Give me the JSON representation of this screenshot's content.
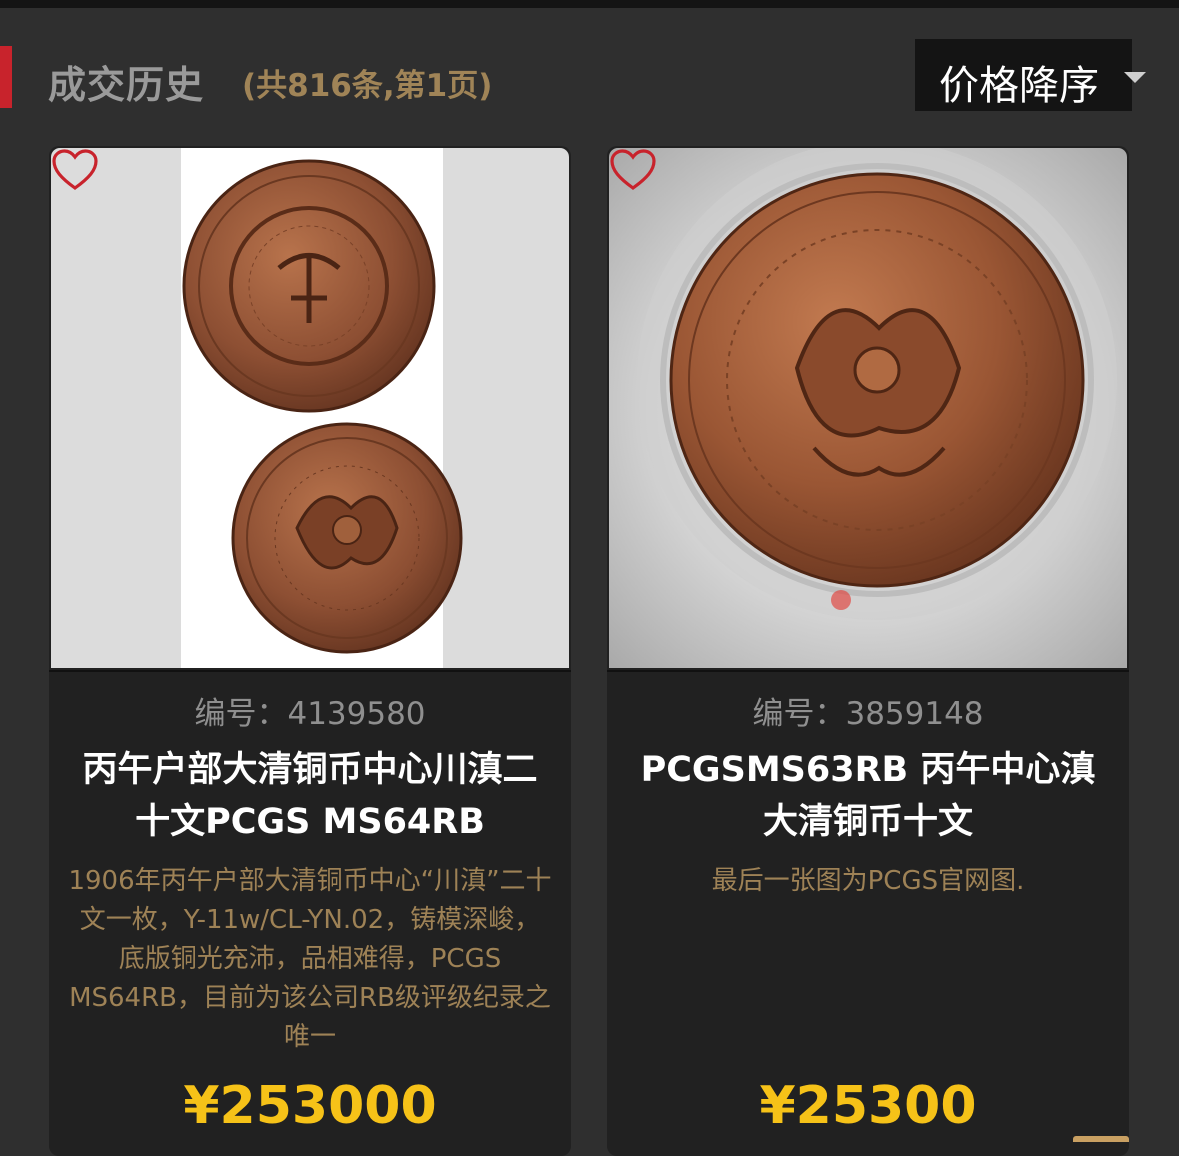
{
  "header": {
    "title": "成交历史",
    "subtitle": "(共816条,第1页)",
    "sort_label": "价格降序"
  },
  "colors": {
    "accent": "#c8232c",
    "price": "#f6c218",
    "description": "#9e8256",
    "favorite_heart": "#c8232c"
  },
  "cards": [
    {
      "number": "编号：4139580",
      "name": "丙午户部大清铜币中心川滇二十文PCGS MS64RB",
      "description": "1906年丙午户部大清铜币中心“川滇”二十文一枚，Y-11w/CL-YN.02，铸模深峻，底版铜光充沛，品相难得，PCGS MS64RB，目前为该公司RB级评级纪录之唯一",
      "price": "¥253000",
      "icon": "heart-outline-icon"
    },
    {
      "number": "编号：3859148",
      "name": "PCGSMS63RB 丙午中心滇大清铜币十文",
      "description": "最后一张图为PCGS官网图.",
      "price": "¥25300",
      "icon": "heart-outline-icon"
    }
  ]
}
